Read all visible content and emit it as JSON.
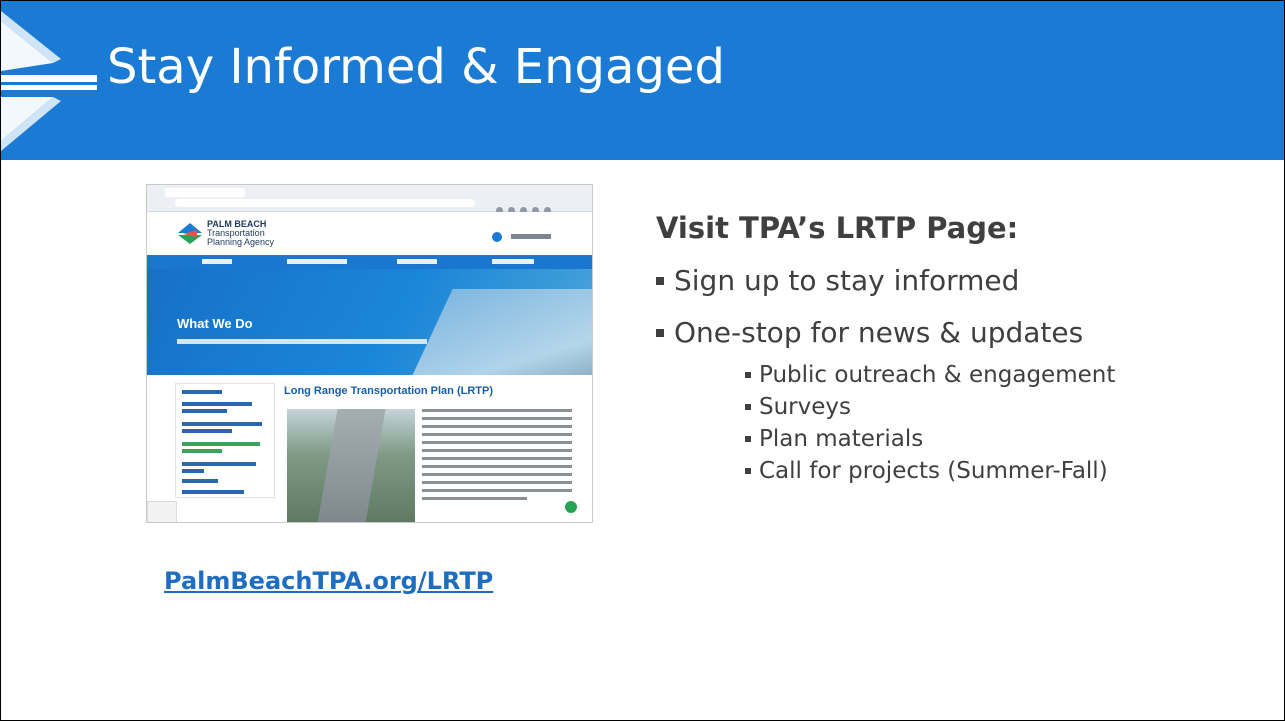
{
  "slide": {
    "title": "Stay Informed & Engaged",
    "link_text": "PalmBeachTPA.org/LRTP",
    "heading": "Visit TPA’s LRTP Page:",
    "bullets": [
      "Sign up to stay informed",
      "One-stop for news & updates"
    ],
    "sub_bullets": [
      "Public outreach & engagement",
      "Surveys",
      "Plan materials",
      "Call for projects (Summer-Fall)"
    ]
  },
  "screenshot": {
    "org_name_line1": "PALM BEACH",
    "org_name_line2": "Transportation",
    "org_name_line3": "Planning Agency",
    "hero_title": "What We Do",
    "page_title": "Long Range Transportation Plan (LRTP)"
  },
  "colors": {
    "header_blue": "#1b7bd4",
    "link_blue": "#1f6dc2",
    "body_text": "#3f3f3f"
  }
}
